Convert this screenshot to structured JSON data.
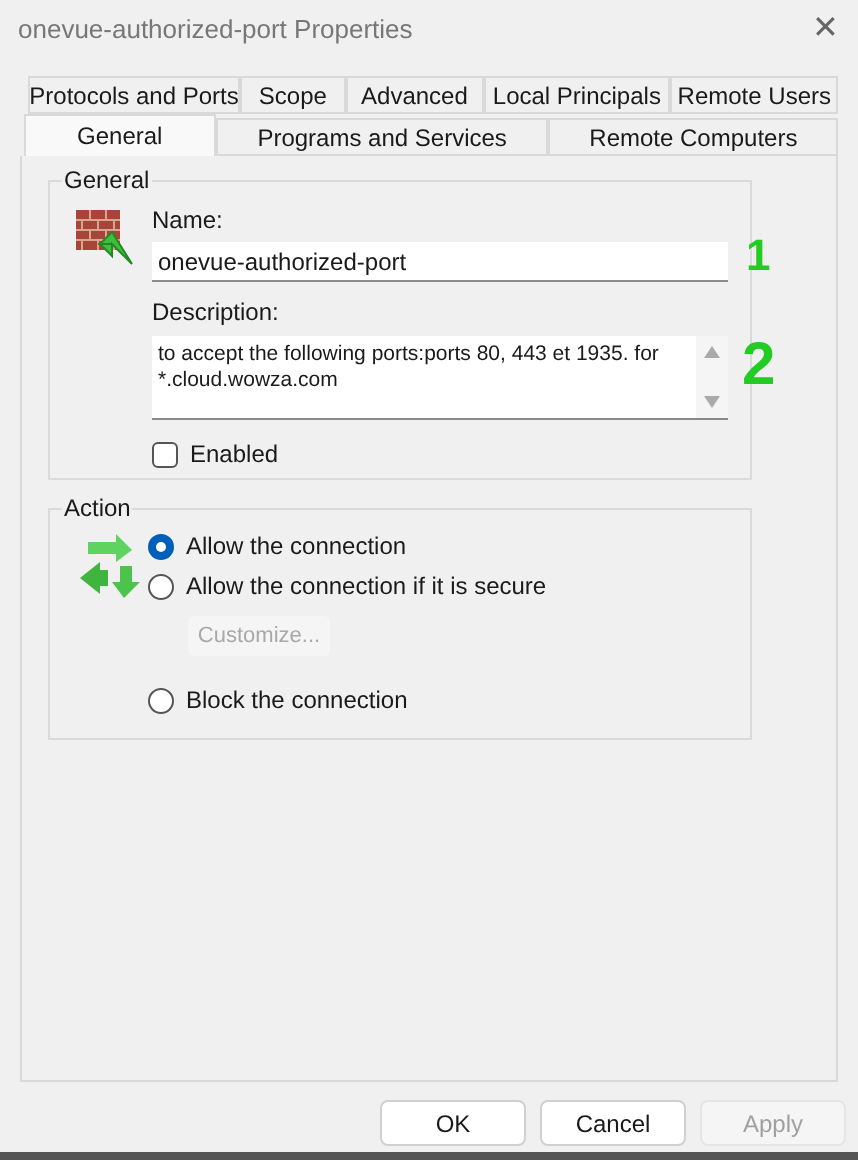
{
  "window": {
    "title": "onevue-authorized-port Properties",
    "close": "✕"
  },
  "tabs": {
    "top_row": [
      {
        "label": "Protocols and Ports",
        "selected": false
      },
      {
        "label": "Scope",
        "selected": false
      },
      {
        "label": "Advanced",
        "selected": false
      },
      {
        "label": "Local Principals",
        "selected": false
      },
      {
        "label": "Remote Users",
        "selected": false
      }
    ],
    "bottom_row": [
      {
        "label": "General",
        "selected": true
      },
      {
        "label": "Programs and Services",
        "selected": false
      },
      {
        "label": "Remote Computers",
        "selected": false
      }
    ]
  },
  "general": {
    "title": "General",
    "name_label": "Name:",
    "name_value": "onevue-authorized-port",
    "description_label": "Description:",
    "description_lines": [
      "to accept the following ports:ports 80, 443 et 1935. for",
      "*.cloud.wowza.com"
    ],
    "enabled": {
      "label": "Enabled",
      "checked": false
    }
  },
  "action": {
    "title": "Action",
    "options": [
      {
        "label": "Allow the connection",
        "selected": true
      },
      {
        "label": "Allow the connection if it is secure",
        "selected": false
      },
      {
        "label": "Block the connection",
        "selected": false
      }
    ],
    "customize": {
      "label": "Customize...",
      "disabled": true
    }
  },
  "annotations": [
    {
      "text": "1"
    },
    {
      "text": "2"
    }
  ],
  "buttons": [
    {
      "label": "OK",
      "disabled": false
    },
    {
      "label": "Cancel",
      "disabled": false
    },
    {
      "label": "Apply",
      "disabled": true
    }
  ]
}
